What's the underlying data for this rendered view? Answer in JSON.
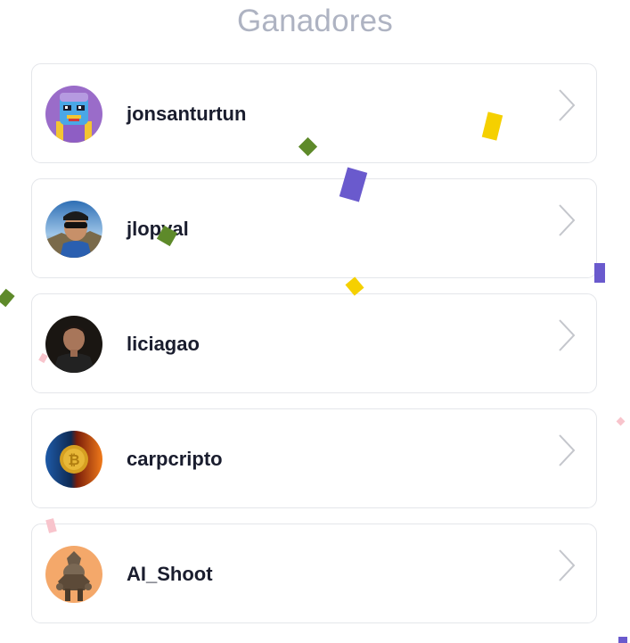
{
  "header": {
    "title": "Ganadores"
  },
  "winners": [
    {
      "username": "jonsanturtun",
      "avatar_icon": "robot-avatar-icon"
    },
    {
      "username": "jlopval",
      "avatar_icon": "selfie-photo-icon"
    },
    {
      "username": "liciagao",
      "avatar_icon": "portrait-photo-icon"
    },
    {
      "username": "carpcripto",
      "avatar_icon": "bitcoin-fire-ice-icon"
    },
    {
      "username": "AI_Shoot",
      "avatar_icon": "sculpture-figure-icon"
    }
  ],
  "colors": {
    "title": "#aeb3c2",
    "username": "#1a1d2e",
    "card_border": "#e4e6ea",
    "chevron": "#c4c6cc",
    "confetti_yellow": "#f5d000",
    "confetti_green": "#5e8a2a",
    "confetti_purple": "#6a5acd",
    "confetti_pink": "#f8c4cc"
  }
}
